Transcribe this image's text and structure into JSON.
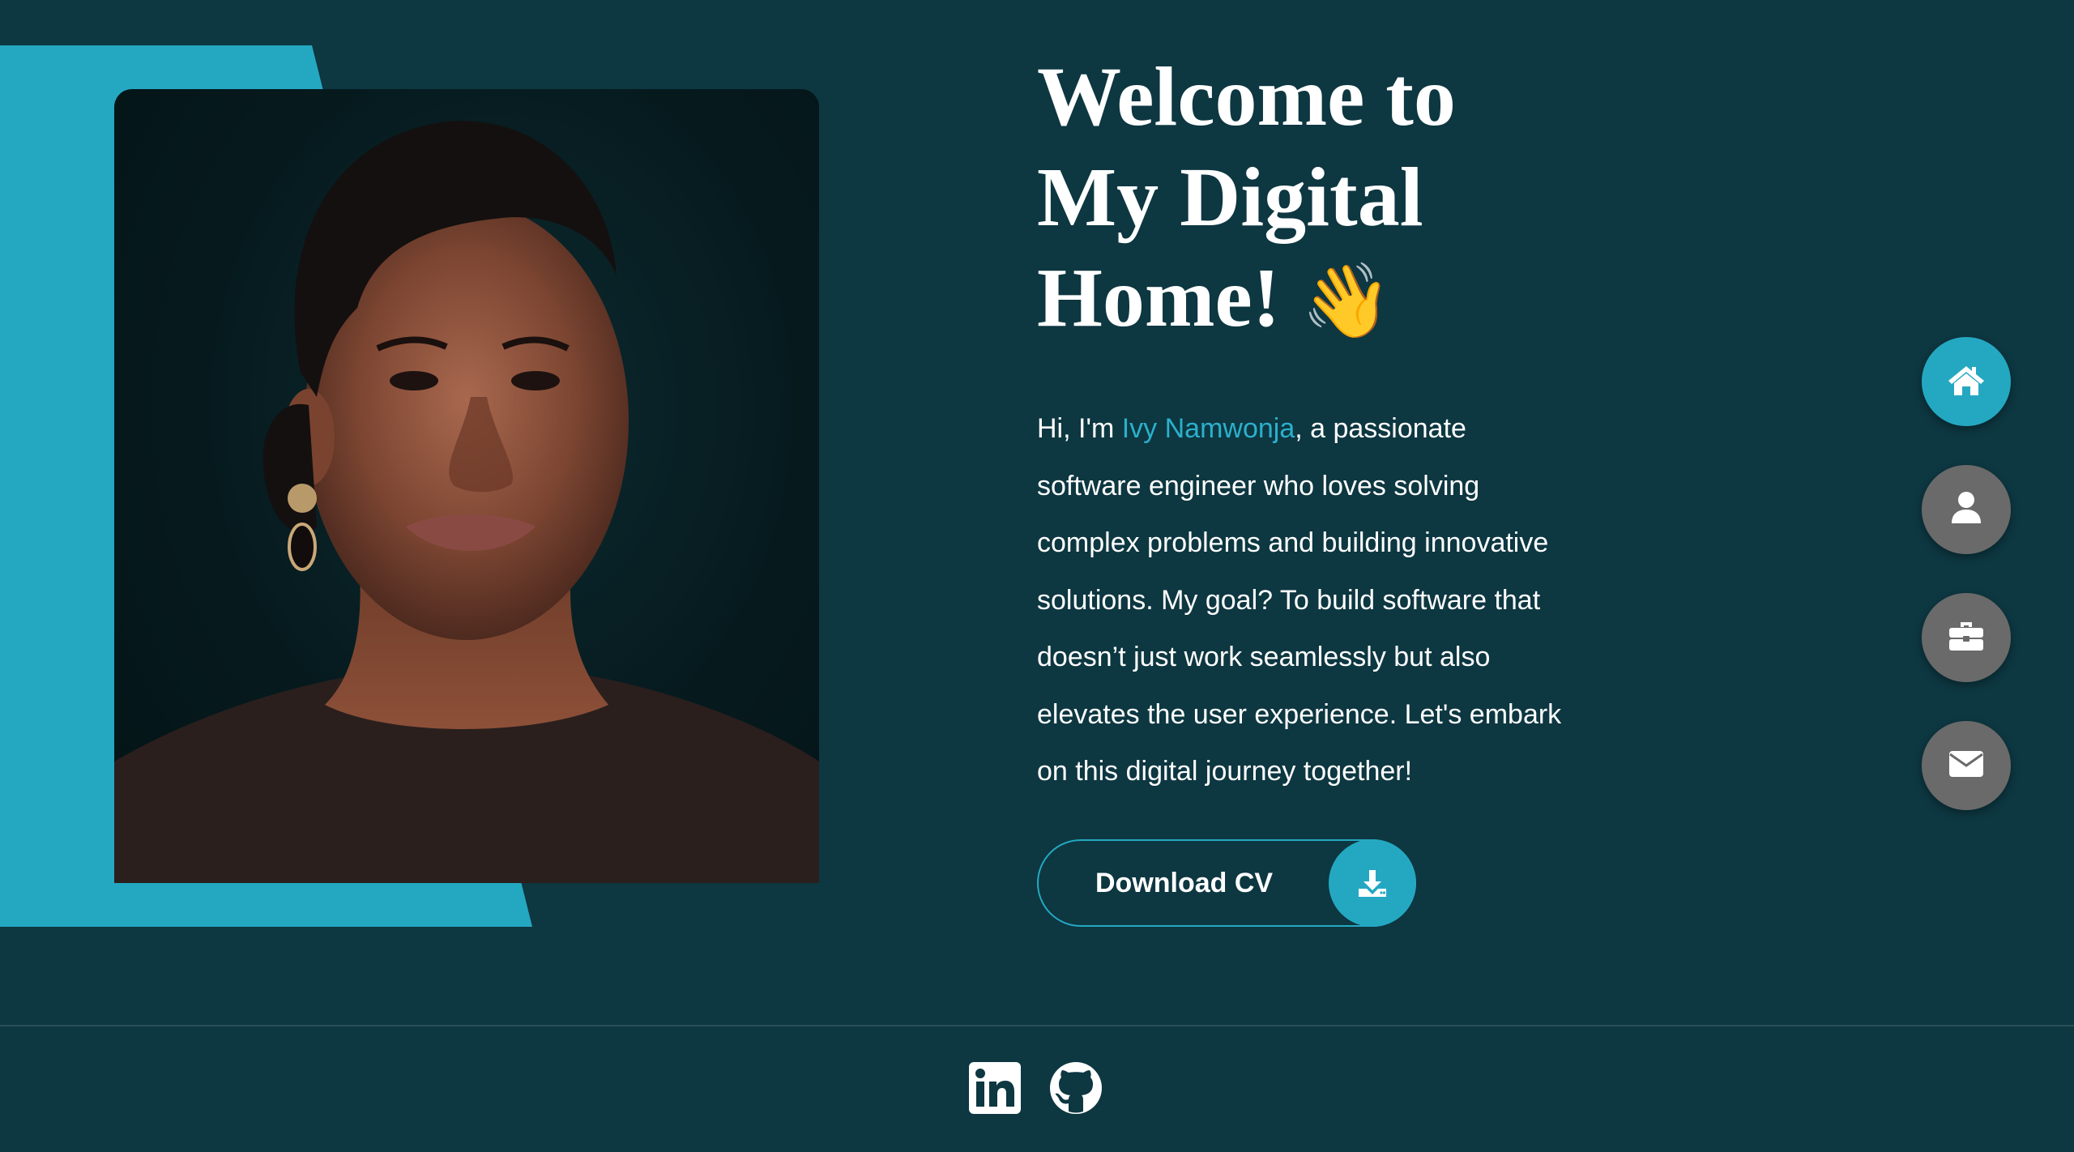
{
  "hero": {
    "title_line1": "Welcome to",
    "title_line2": "My Digital",
    "title_line3": "Home!",
    "title_emoji": "👋",
    "intro_prefix": "Hi, I'm ",
    "name": "Ivy Namwonja",
    "intro_rest": ", a passionate software engineer who loves solving complex problems and building innovative solutions. My goal? To build software that doesn’t just work seamlessly but also elevates the user experience. Let's embark on this digital journey together!"
  },
  "cv_button": {
    "label": "Download CV",
    "icon": "download-icon"
  },
  "side_nav": [
    {
      "icon": "home-icon",
      "active": true
    },
    {
      "icon": "user-icon",
      "active": false
    },
    {
      "icon": "briefcase-icon",
      "active": false
    },
    {
      "icon": "envelope-icon",
      "active": false
    }
  ],
  "footer": {
    "icons": [
      "linkedin-icon",
      "github-icon"
    ]
  },
  "colors": {
    "background": "#0d3741",
    "accent": "#24a8c2",
    "nav_inactive": "#6a6a6a",
    "text": "#ffffff"
  }
}
